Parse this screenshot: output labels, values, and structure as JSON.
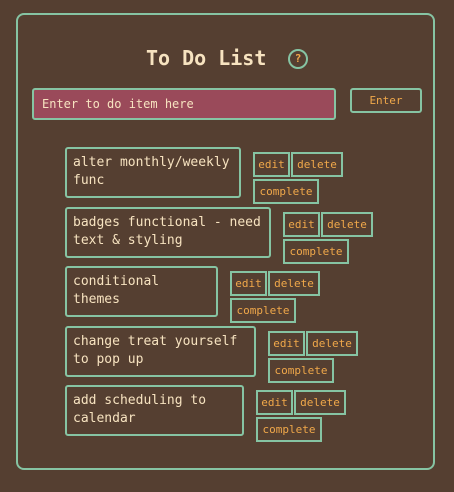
{
  "header": {
    "title": "To Do List",
    "help_glyph": "?"
  },
  "entry": {
    "placeholder": "Enter to do item here",
    "value": "",
    "enter_label": "Enter"
  },
  "actions": {
    "edit": "edit",
    "delete": "delete",
    "complete": "complete"
  },
  "colors": {
    "background": "#553f31",
    "border": "#86c4a3",
    "text": "#f7e3c0",
    "accent": "#f0a84a",
    "input_bg": "#9a4a5a"
  },
  "items": [
    {
      "text": "alter monthly/weekly\nfunc"
    },
    {
      "text": "badges functional - need\ntext & styling"
    },
    {
      "text": "conditional\nthemes"
    },
    {
      "text": "change treat yourself\nto pop up"
    },
    {
      "text": "add scheduling to\ncalendar"
    }
  ]
}
